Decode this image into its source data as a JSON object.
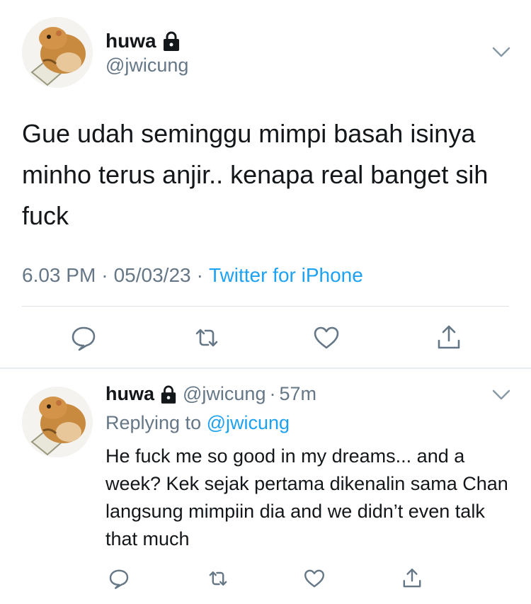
{
  "main_tweet": {
    "name": "huwa",
    "handle": "@jwicung",
    "text": "Gue udah seminggu mimpi basah isinya minho terus anjir.. kenapa real banget sih fuck",
    "time": "6.03 PM",
    "date": "05/03/23",
    "source": "Twitter for iPhone",
    "actions": [
      "reply-icon",
      "retweet-icon",
      "like-icon",
      "share-icon"
    ]
  },
  "reply_tweet": {
    "name": "huwa",
    "handle": "@jwicung",
    "time_ago": "57m",
    "replying_prefix": "Replying to",
    "replying_to": "@jwicung",
    "text": "He fuck me so good in my dreams... and a week? Kek sejak pertama dikenalin sama Chan langsung mimpiin dia and we didn’t even talk that much",
    "actions": [
      "reply-icon",
      "retweet-icon",
      "like-icon",
      "share-icon"
    ]
  },
  "icons": {
    "lock": "lock-icon",
    "chevron": "chevron-down-icon",
    "avatar": "hamster-avatar"
  },
  "colors": {
    "text": "#14171a",
    "secondary": "#657786",
    "link": "#1da1f2",
    "divider": "#e6ecf0"
  }
}
